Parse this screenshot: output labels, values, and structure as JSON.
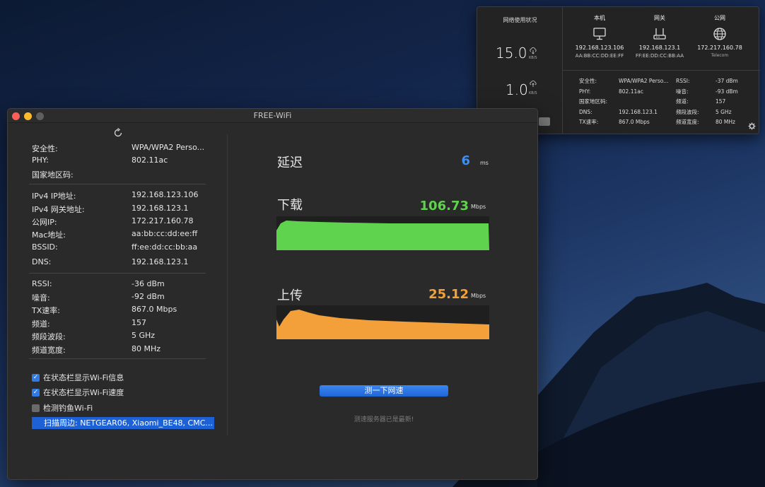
{
  "colors": {
    "accent": "#2f7ae5",
    "latency": "#3f8ff0",
    "download": "#5fd34d",
    "upload": "#f3a03a",
    "window_bg": "#2a2a2a"
  },
  "popover": {
    "title": "网络使用状况",
    "download_speed": "15.0",
    "download_unit": "KB/S",
    "upload_speed": "1.0",
    "upload_unit": "KB/S",
    "hosts": [
      {
        "name": "本机",
        "icon": "monitor-icon",
        "ip": "192.168.123.106",
        "mac": "AA:BB:CC:DD:EE:FF"
      },
      {
        "name": "网关",
        "icon": "router-icon",
        "ip": "192.168.123.1",
        "mac": "FF:EE:DD:CC:BB:AA"
      },
      {
        "name": "公网",
        "icon": "globe-icon",
        "ip": "172.217.160.78",
        "isp": "Telecom"
      }
    ],
    "info_left": [
      {
        "label": "安全性:",
        "value": "WPA/WPA2 Perso..."
      },
      {
        "label": "PHY:",
        "value": "802.11ac"
      },
      {
        "label": "国家地区码:",
        "value": ""
      },
      {
        "label": "DNS:",
        "value": "192.168.123.1"
      },
      {
        "label": "TX速率:",
        "value": "867.0 Mbps"
      }
    ],
    "info_right": [
      {
        "label": "RSSI:",
        "value": "-37 dBm"
      },
      {
        "label": "噪音:",
        "value": "-93 dBm"
      },
      {
        "label": "频道:",
        "value": "157"
      },
      {
        "label": "频段波段:",
        "value": "5 GHz"
      },
      {
        "label": "频道宽度:",
        "value": "80 MHz"
      }
    ]
  },
  "window": {
    "title": "FREE-WiFi",
    "group1": [
      {
        "label": "安全性:",
        "value": "WPA/WPA2 Perso..."
      },
      {
        "label": "PHY:",
        "value": "802.11ac"
      },
      {
        "label": "国家地区码:",
        "value": ""
      }
    ],
    "group2": [
      {
        "label": "IPv4 IP地址:",
        "value": "192.168.123.106"
      },
      {
        "label": "IPv4 网关地址:",
        "value": "192.168.123.1"
      },
      {
        "label": "公网IP:",
        "value": "172.217.160.78"
      },
      {
        "label": "Mac地址:",
        "value": "aa:bb:cc:dd:ee:ff"
      },
      {
        "label": "BSSID:",
        "value": "ff:ee:dd:cc:bb:aa"
      },
      {
        "label": "DNS:",
        "value": "192.168.123.1"
      }
    ],
    "group3": [
      {
        "label": "RSSI:",
        "value": "-36 dBm"
      },
      {
        "label": "噪音:",
        "value": "-92 dBm"
      },
      {
        "label": "TX速率:",
        "value": "867.0 Mbps"
      },
      {
        "label": "频道:",
        "value": "157"
      },
      {
        "label": "频段波段:",
        "value": "5 GHz"
      },
      {
        "label": "频道宽度:",
        "value": "80 MHz"
      }
    ],
    "options": [
      {
        "label": "在状态栏显示Wi-Fi信息",
        "checked": true
      },
      {
        "label": "在状态栏显示Wi-Fi速度",
        "checked": true
      },
      {
        "label": "检测钓鱼Wi-Fi",
        "checked": false
      }
    ],
    "scan_text": "扫描周边: NETGEAR06, Xiaomi_BE48, CMC...",
    "latency": {
      "label": "延迟",
      "value": "6",
      "unit": "ms"
    },
    "download": {
      "label": "下载",
      "value": "106.73",
      "unit": "Mbps"
    },
    "upload": {
      "label": "上传",
      "value": "25.12",
      "unit": "Mbps"
    },
    "speed_button": "测一下网速",
    "status_note": "测速服务器已是最新!"
  }
}
